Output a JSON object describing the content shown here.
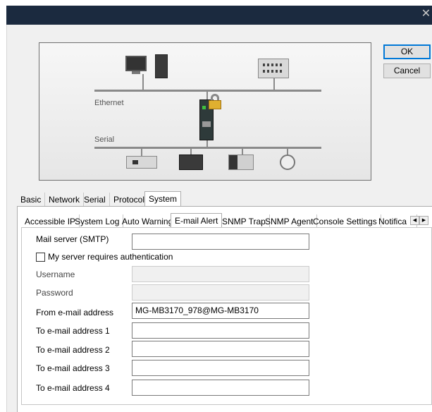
{
  "window": {
    "close_glyph": "✕"
  },
  "buttons": {
    "ok": "OK",
    "cancel": "Cancel"
  },
  "diagram": {
    "ethernet_label": "Ethernet",
    "serial_label": "Serial"
  },
  "main_tabs": [
    "Basic",
    "Network",
    "Serial",
    "Protocol",
    "System"
  ],
  "main_tab_selected": "System",
  "sub_tabs": [
    "Accessible IP",
    "System Log",
    "Auto Warning",
    "E-mail Alert",
    "SNMP Trap",
    "SNMP Agent",
    "Console Settings",
    "Notifica"
  ],
  "sub_tab_selected": "E-mail Alert",
  "form": {
    "mail_server_label": "Mail server (SMTP)",
    "mail_server_value": "",
    "auth_checkbox_label": "My server requires authentication",
    "auth_checked": false,
    "username_label": "Username",
    "password_label": "Password",
    "from_label": "From e-mail address",
    "from_value": "MG-MB3170_978@MG-MB3170",
    "to1_label": "To e-mail address 1",
    "to2_label": "To e-mail address 2",
    "to3_label": "To e-mail address 3",
    "to4_label": "To e-mail address 4"
  },
  "colors": {
    "titlebar": "#1b2a3f",
    "dialog_bg": "#f0f0f0",
    "accent": "#0078d7"
  },
  "icons": [
    "close-icon",
    "pc-monitor-icon",
    "pc-tower-icon",
    "plc-icon",
    "gateway-device-icon",
    "lock-icon",
    "serial-device-icons",
    "scroll-left-icon",
    "scroll-right-icon"
  ]
}
